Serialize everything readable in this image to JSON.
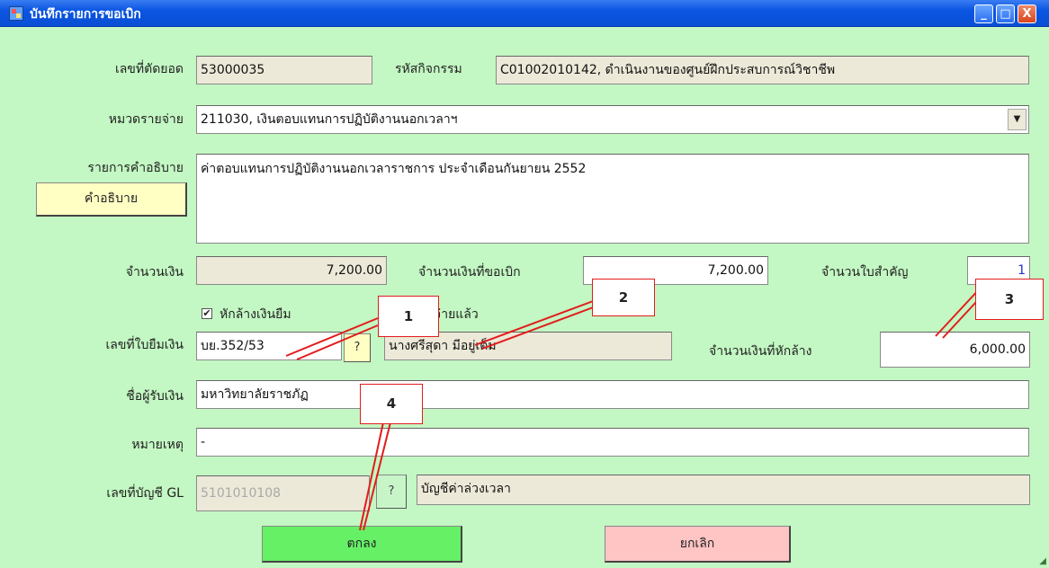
{
  "window": {
    "title": "บันทึกรายการขอเบิก",
    "minimize": "_",
    "maximize": "□",
    "close": "X"
  },
  "form": {
    "cutoff_no": {
      "label": "เลขที่ตัดยอด",
      "value": "53000035"
    },
    "activity_code": {
      "label": "รหัสกิจกรรม",
      "value": "C01002010142, ดำเนินงานของศูนย์ฝึกประสบการณ์วิชาชีพ"
    },
    "expense_category": {
      "label": "หมวดรายจ่าย",
      "value": "211030, เงินตอบแทนการปฏิบัติงานนอกเวลาฯ",
      "dropdown": "▼"
    },
    "description": {
      "label": "รายการคำอธิบาย",
      "value": "ค่าตอบแทนการปฏิบัติงานนอกเวลาราชการ ประจำเดือนกันยายน 2552",
      "button": "คำอธิบาย"
    },
    "amount": {
      "label": "จำนวนเงิน",
      "value": "7,200.00"
    },
    "requested_amount": {
      "label": "จำนวนเงินที่ขอเบิก",
      "value": "7,200.00"
    },
    "receipt_count": {
      "label": "จำนวนใบสำคัญ",
      "value": "1"
    },
    "deduct_loan": {
      "label": "หักล้างเงินยืม",
      "checked": true,
      "check_mark": "✔"
    },
    "paid": {
      "label": "จ่ายแล้ว"
    },
    "loan_no": {
      "label": "เลขที่ใบยืมเงิน",
      "value": "บย.352/53",
      "lookup": "?"
    },
    "borrower_name": {
      "value": "นางศรีสุดา  มีอยู่เต็ม"
    },
    "deduct_amount": {
      "label": "จำนวนเงินที่หักล้าง",
      "value": "6,000.00"
    },
    "payee": {
      "label": "ชื่อผู้รับเงิน",
      "value": "มหาวิทยาลัยราชภัฏ"
    },
    "remark": {
      "label": "หมายเหตุ",
      "value": "-"
    },
    "gl_account": {
      "label": "เลขที่บัญชี GL",
      "value": "5101010108",
      "lookup": "?",
      "name": "บัญชีค่าล่วงเวลา"
    }
  },
  "buttons": {
    "ok": "ตกลง",
    "cancel": "ยกเลิก"
  },
  "callouts": [
    "1",
    "2",
    "3",
    "4"
  ],
  "colors": {
    "background": "#c3f7c3",
    "titlebar": "#0a55e2",
    "ok_button": "#66f066",
    "cancel_button": "#ffc4c4",
    "callout_border": "#e31c1c",
    "yellow_button": "#ffffc4"
  }
}
